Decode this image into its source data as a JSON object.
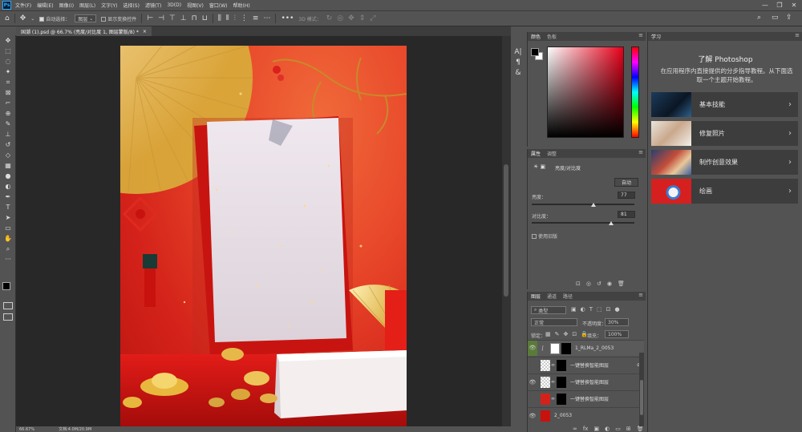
{
  "menu": {
    "logo": "Ps",
    "items": [
      "文件(F)",
      "编辑(E)",
      "图像(I)",
      "图层(L)",
      "文字(Y)",
      "选择(S)",
      "滤镜(T)",
      "3D(D)",
      "视图(V)",
      "窗口(W)",
      "帮助(H)"
    ]
  },
  "options": {
    "auto_select_label": "自动选择：",
    "auto_select_value": "图层",
    "transform_label": "显示变换控件",
    "mode_label": "3D 模式："
  },
  "document": {
    "tab_title": "国潮 (1).psd @ 66.7% (亮度/对比度 1, 图层蒙版/8) *",
    "zoom": "66.67%",
    "doc_size": "文档:4.0M/20.9M"
  },
  "color_panel": {
    "tabs": [
      "颜色",
      "色板"
    ],
    "active_tab": "颜色"
  },
  "properties_panel": {
    "tabs": [
      "属性",
      "调整"
    ],
    "title": "亮度/对比度",
    "auto_button": "自动",
    "brightness_label": "亮度：",
    "brightness_value": "77",
    "brightness_fraction": 0.6,
    "contrast_label": "对比度：",
    "contrast_value": "81",
    "contrast_fraction": 0.77,
    "legacy_label": "使用旧版"
  },
  "layers_panel": {
    "tabs": [
      "图层",
      "通道",
      "路径"
    ],
    "filter_kind": "类型",
    "blend_mode": "正常",
    "opacity_label": "不透明度：",
    "opacity_value": "30%",
    "lock_label": "锁定：",
    "fill_label": "填充：",
    "fill_value": "100%",
    "layers": [
      {
        "name": "1_RLMa_2_0053",
        "visible": true
      },
      {
        "name": "一键替换智能图层",
        "visible": false
      },
      {
        "name": "一键替换智能图层",
        "visible": true
      },
      {
        "name": "一键替换智能图层",
        "visible": false
      },
      {
        "name": "2_0053",
        "visible": true
      }
    ]
  },
  "learn_panel": {
    "tab": "学习",
    "heading": "了解 Photoshop",
    "description": "在应用程序内直接提供的分步指导教程。从下面选取一个主题开始教程。",
    "topics": [
      "基本技能",
      "修复照片",
      "制作创意效果",
      "绘画"
    ]
  },
  "colors": {
    "ui_bg": "#535353",
    "canvas_bg": "#282828",
    "accent_red": "#d4221a",
    "gold": "#e8c56a"
  }
}
